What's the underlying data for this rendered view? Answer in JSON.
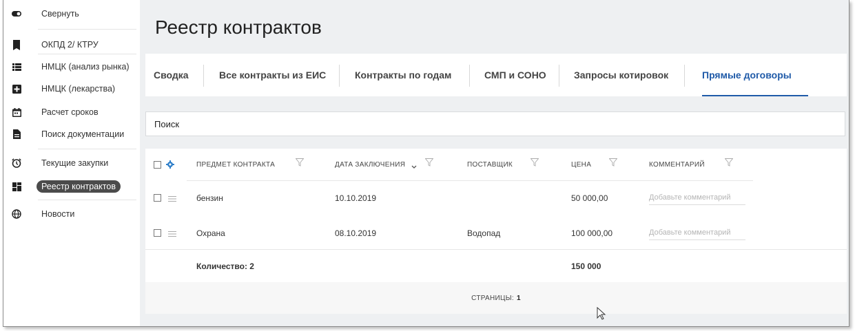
{
  "sidebar": {
    "items": [
      {
        "label": "Свернуть",
        "icon": "toggle-icon"
      },
      {
        "label": "ОКПД 2/ КТРУ",
        "icon": "bookmark-icon"
      },
      {
        "label": "НМЦК (анализ рынка)",
        "icon": "list-icon"
      },
      {
        "label": "НМЦК (лекарства)",
        "icon": "medical-plus-icon"
      },
      {
        "label": "Расчет сроков",
        "icon": "calendar-icon"
      },
      {
        "label": "Поиск документации",
        "icon": "document-icon"
      },
      {
        "label": "Текущие закупки",
        "icon": "alarm-clock-icon"
      },
      {
        "label": "Реестр контрактов",
        "icon": "dashboard-icon",
        "active": true
      },
      {
        "label": "Новости",
        "icon": "globe-icon"
      }
    ]
  },
  "main": {
    "title": "Реестр контрактов",
    "tabs": [
      {
        "label": "Сводка"
      },
      {
        "label": "Все контракты из ЕИС"
      },
      {
        "label": "Контракты по годам"
      },
      {
        "label": "СМП и СОНО"
      },
      {
        "label": "Запросы котировок"
      },
      {
        "label": "Прямые договоры",
        "active": true
      }
    ],
    "search": {
      "value": "Поиск"
    },
    "table": {
      "columns": [
        {
          "label": "ПРЕДМЕТ КОНТРАКТА"
        },
        {
          "label": "ДАТА ЗАКЛЮЧЕНИЯ"
        },
        {
          "label": "ПОСТАВЩИК"
        },
        {
          "label": "ЦЕНА"
        },
        {
          "label": "КОММЕНТАРИЙ"
        }
      ],
      "rows": [
        {
          "subject": "бензин",
          "date": "10.10.2019",
          "supplier": "",
          "price": "50 000,00",
          "comment_placeholder": "Добавьте комментарий"
        },
        {
          "subject": "Охрана",
          "date": "08.10.2019",
          "supplier": "Водопад",
          "price": "100 000,00",
          "comment_placeholder": "Добавьте комментарий"
        }
      ],
      "footer": {
        "count_label": "Количество: 2",
        "total": "150 000"
      },
      "pagination": {
        "label": "СТРАНИЦЫ:",
        "current": "1"
      }
    }
  },
  "colors": {
    "accent": "#1f5aa8",
    "active_nav_bg": "#4b4b4b",
    "background": "#eef0f2"
  }
}
